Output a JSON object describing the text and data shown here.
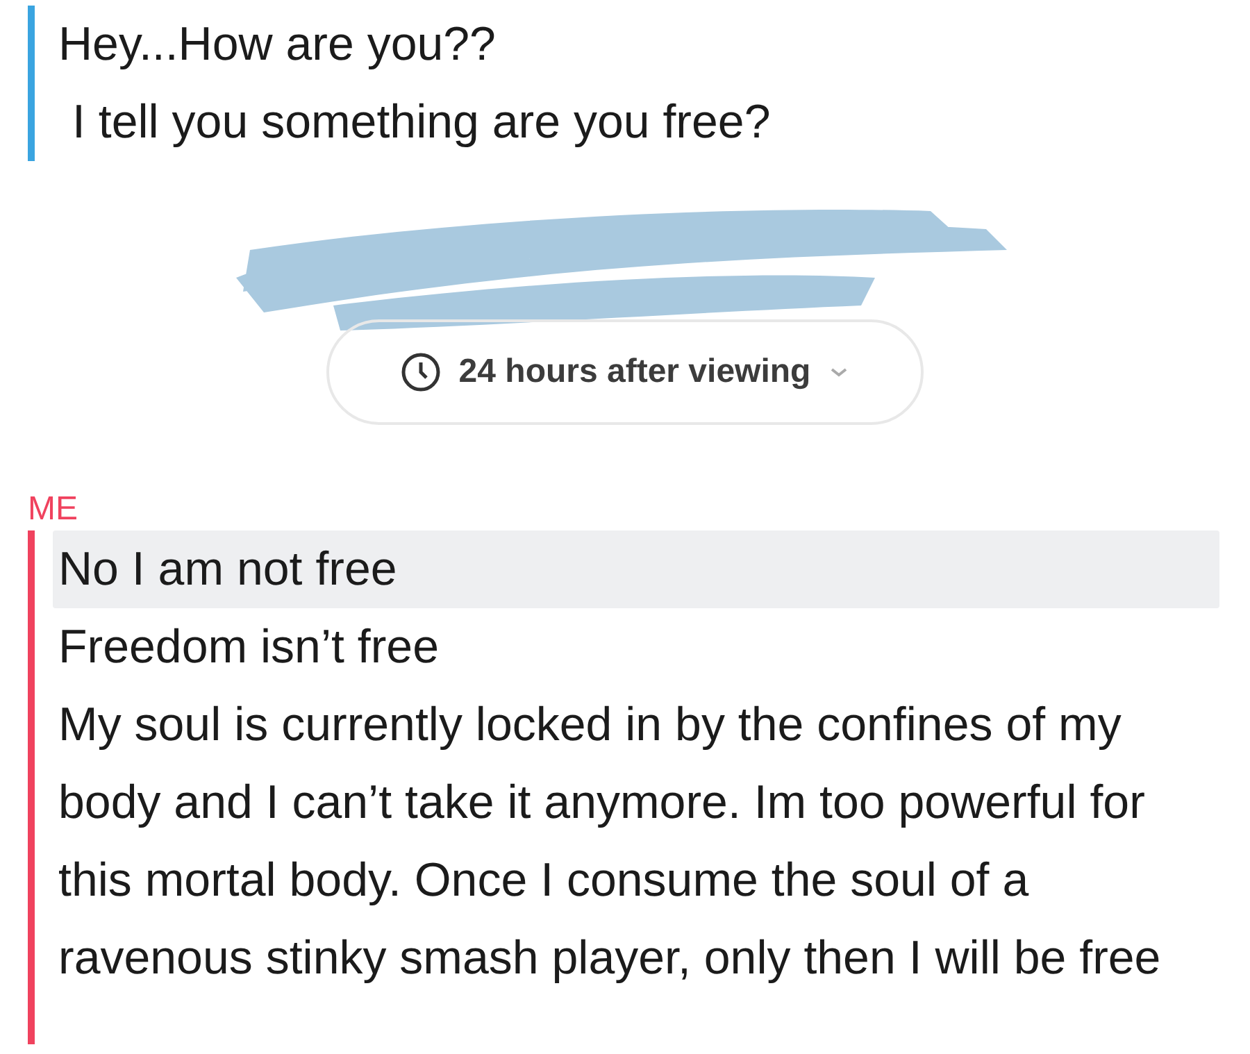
{
  "groups": [
    {
      "kind": "messages",
      "color": "#3aa4e0",
      "messages": [
        {
          "text": "Hey...How are you??",
          "selected": false
        },
        {
          "text": "I tell you something are you free?",
          "selected": false
        }
      ]
    },
    {
      "kind": "redacted"
    },
    {
      "kind": "timer",
      "text": "24 hours after viewing"
    },
    {
      "kind": "messages",
      "sender": "ME",
      "color": "#f0425e",
      "messages": [
        {
          "text": "No I am not free",
          "selected": true
        },
        {
          "text": "Freedom isn’t free",
          "selected": false
        },
        {
          "text": "My soul is currently locked in by the confines of my body and I can’t take it anymore. Im too powerful for this mortal body. Once I consume the soul of a ravenous stinky smash player, only then I will be free",
          "selected": false
        }
      ]
    }
  ]
}
